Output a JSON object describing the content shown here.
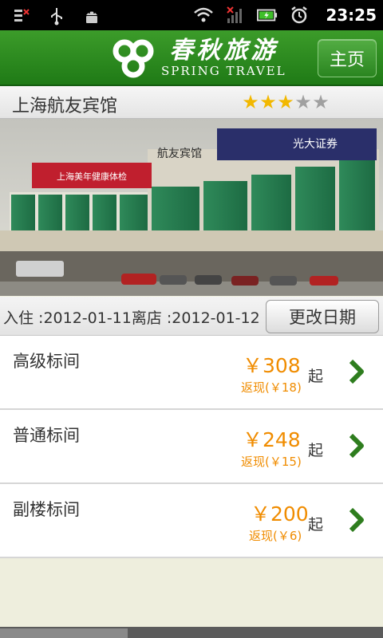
{
  "status_bar": {
    "time": "23:25",
    "icons": [
      "notification-icon",
      "usb-icon",
      "android-icon",
      "wifi-icon",
      "signal-no-sim-icon",
      "battery-charging-icon",
      "alarm-icon"
    ]
  },
  "header": {
    "logo_cn": "春秋旅游",
    "logo_en": "SPRING TRAVEL",
    "home_label": "主页",
    "brand_color": "#2a8a1e"
  },
  "hotel": {
    "name": "上海航友宾馆",
    "rating": 3,
    "max_rating": 5,
    "photo_signs": {
      "left_banner": "上海美年健康体检",
      "roof_sign": "航友宾馆",
      "right_banner": "光大证券"
    }
  },
  "dates": {
    "summary": "入住 :2012-01-11离店 :2012-01-12",
    "change_label": "更改日期"
  },
  "rooms": [
    {
      "name": "高级标间",
      "price": "￥308",
      "suffix": "起",
      "cashback": "返现(￥18)"
    },
    {
      "name": "普通标间",
      "price": "￥248",
      "suffix": "起",
      "cashback": "返现(￥15)"
    },
    {
      "name": "副楼标间",
      "price": "￥200",
      "suffix": "起",
      "cashback": "返现(￥6)"
    }
  ],
  "colors": {
    "price": "#f08c00",
    "star_filled": "#f2b800",
    "star_empty": "#a0a0a0",
    "chevron": "#2e7d1e"
  }
}
